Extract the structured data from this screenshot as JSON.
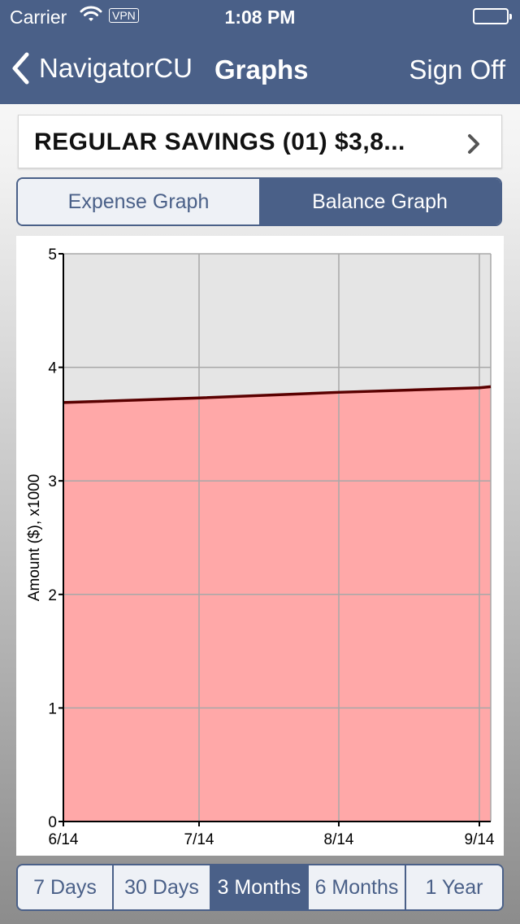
{
  "status_bar": {
    "carrier": "Carrier",
    "vpn": "VPN",
    "time": "1:08 PM",
    "battery_level": 1.0
  },
  "nav": {
    "back_label": "NavigatorCU",
    "title": "Graphs",
    "sign_off": "Sign Off"
  },
  "account": {
    "label": "REGULAR SAVINGS (01) $3,8..."
  },
  "graph_toggle": {
    "options": [
      "Expense Graph",
      "Balance Graph"
    ],
    "selected": "Balance Graph"
  },
  "range_selector": {
    "options": [
      "7 Days",
      "30 Days",
      "3 Months",
      "6 Months",
      "1 Year"
    ],
    "selected": "3 Months"
  },
  "colors": {
    "nav_bar": "#4a6088",
    "area_fill": "#ffa8a8",
    "line": "#5a0000",
    "plot_bg": "#e5e5e5"
  },
  "chart_data": {
    "type": "area",
    "ylabel": "Amount ($), x1000",
    "xlabel": "",
    "ylim": [
      0,
      5
    ],
    "yticks": [
      "0",
      "1",
      "2",
      "3",
      "4",
      "5"
    ],
    "xticks": [
      "6/14",
      "7/14",
      "8/14",
      "9/14"
    ],
    "grid": true,
    "series": [
      {
        "x": [
          "6/14",
          "7/14",
          "8/14",
          "9/14",
          "9/14"
        ],
        "values": [
          3.69,
          3.73,
          3.78,
          3.82,
          3.83
        ]
      }
    ]
  }
}
